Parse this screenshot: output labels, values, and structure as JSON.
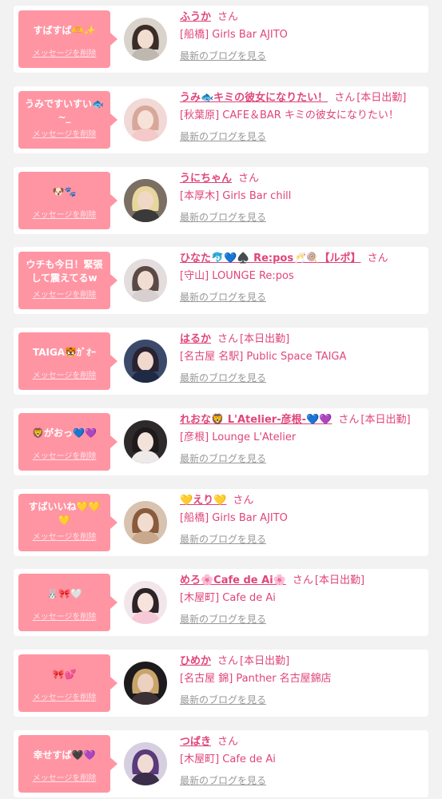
{
  "theme": {
    "accent": "#e0457b",
    "bubble": "#ff95a3",
    "card": "#ffffff",
    "background": "#f2f2f2",
    "link_gray": "#999999"
  },
  "entries": [
    {
      "message": "すばすば🫶✨",
      "delete_label": "メッセージを削除",
      "name": "ふうか",
      "suffix": "さん",
      "work_status": "",
      "shop": "[船橋] Girls Bar AJITO",
      "blog_label": "最新のブログを見る",
      "avatar_icon": "avatar-photo",
      "avatar_colors": {
        "bg": "#d9d3cc",
        "hair": "#3a2d28",
        "skin": "#f3ddd0",
        "shirt": "#bfb8b0"
      }
    },
    {
      "message": "うみですいすい🐟~_",
      "delete_label": "メッセージを削除",
      "name": "うみ🐟キミの彼女になりたい！",
      "suffix": "さん",
      "work_status": "[本日出勤]",
      "shop": "[秋葉原] CAFE＆BAR キミの彼女になりたい！",
      "blog_label": "最新のブログを見る",
      "avatar_icon": "avatar-photo",
      "avatar_colors": {
        "bg": "#f1d9d6",
        "hair": "#d7a89a",
        "skin": "#f7e2da",
        "shirt": "#f4c9c9"
      }
    },
    {
      "message": "🐶🐾",
      "delete_label": "メッセージを削除",
      "name": "うにちゃん",
      "suffix": "さん",
      "work_status": "",
      "shop": "[本厚木] Girls Bar chill",
      "blog_label": "最新のブログを見る",
      "avatar_icon": "avatar-photo",
      "avatar_colors": {
        "bg": "#7b6f64",
        "hair": "#e8d79c",
        "skin": "#f0d7c6",
        "shirt": "#3a3a3a"
      }
    },
    {
      "message": "ウチも今日！緊張して震えてるw",
      "delete_label": "メッセージを削除",
      "name": "ひなた🐬💙♠️ Re:pos🥂🍭【ルポ】",
      "suffix": "さん",
      "work_status": "",
      "shop": "[守山] LOUNGE Re:pos",
      "blog_label": "最新のブログを見る",
      "avatar_icon": "avatar-photo",
      "avatar_colors": {
        "bg": "#e3dddd",
        "hair": "#5b4a44",
        "skin": "#f2ddd2",
        "shirt": "#d8d0d0"
      }
    },
    {
      "message": "TAIGA🐯ｶﾞｵｰ",
      "delete_label": "メッセージを削除",
      "name": "はるか",
      "suffix": "さん",
      "work_status": "[本日出勤]",
      "shop": "[名古屋 名駅] Public Space TAIGA",
      "blog_label": "最新のブログを見る",
      "avatar_icon": "avatar-photo",
      "avatar_colors": {
        "bg": "#3b4a6b",
        "hair": "#2b2230",
        "skin": "#f0d8cc",
        "shirt": "#1f2a44"
      }
    },
    {
      "message": "🦁がおっ💙💜",
      "delete_label": "メッセージを削除",
      "name": "れおな🦁 L'Atelier-彦根-💙💜",
      "suffix": "さん",
      "work_status": "[本日出勤]",
      "shop": "[彦根] Lounge L'Atelier",
      "blog_label": "最新のブログを見る",
      "avatar_icon": "avatar-photo",
      "avatar_colors": {
        "bg": "#2e2a2c",
        "hair": "#1e1a1c",
        "skin": "#f3e2da",
        "shirt": "#eeeaea"
      }
    },
    {
      "message": "すばいいね💛💛💛",
      "delete_label": "メッセージを削除",
      "name": "💛えり💛",
      "suffix": "さん",
      "work_status": "",
      "shop": "[船橋] Girls Bar AJITO",
      "blog_label": "最新のブログを見る",
      "avatar_icon": "avatar-photo",
      "avatar_colors": {
        "bg": "#d8c3b0",
        "hair": "#8a5a3c",
        "skin": "#f2dccd",
        "shirt": "#c9a98e"
      }
    },
    {
      "message": "🐰🎀🤍",
      "delete_label": "メッセージを削除",
      "name": "めろ🌸Cafe de Ai🌸",
      "suffix": "さん",
      "work_status": "[本日出勤]",
      "shop": "[木屋町] Cafe de Ai",
      "blog_label": "最新のブログを見る",
      "avatar_icon": "avatar-photo",
      "avatar_colors": {
        "bg": "#f2e6ea",
        "hair": "#2d2428",
        "skin": "#f6e3dc",
        "shirt": "#f7c9d7"
      }
    },
    {
      "message": "🎀💕",
      "delete_label": "メッセージを削除",
      "name": "ひめか",
      "suffix": "さん",
      "work_status": "[本日出勤]",
      "shop": "[名古屋 錦] Panther 名古屋錦店",
      "blog_label": "最新のブログを見る",
      "avatar_icon": "avatar-photo",
      "avatar_colors": {
        "bg": "#1c1a1c",
        "hair": "#c9a36a",
        "skin": "#ecd0c0",
        "shirt": "#3a3036"
      }
    },
    {
      "message": "幸せすば🖤💜",
      "delete_label": "メッセージを削除",
      "name": "つばき",
      "suffix": "さん",
      "work_status": "",
      "shop": "[木屋町] Cafe de Ai",
      "blog_label": "最新のブログを見る",
      "avatar_icon": "avatar-photo",
      "avatar_colors": {
        "bg": "#d6cfe0",
        "hair": "#5a3a7a",
        "skin": "#f1dcd4",
        "shirt": "#3b2e4a"
      }
    }
  ]
}
